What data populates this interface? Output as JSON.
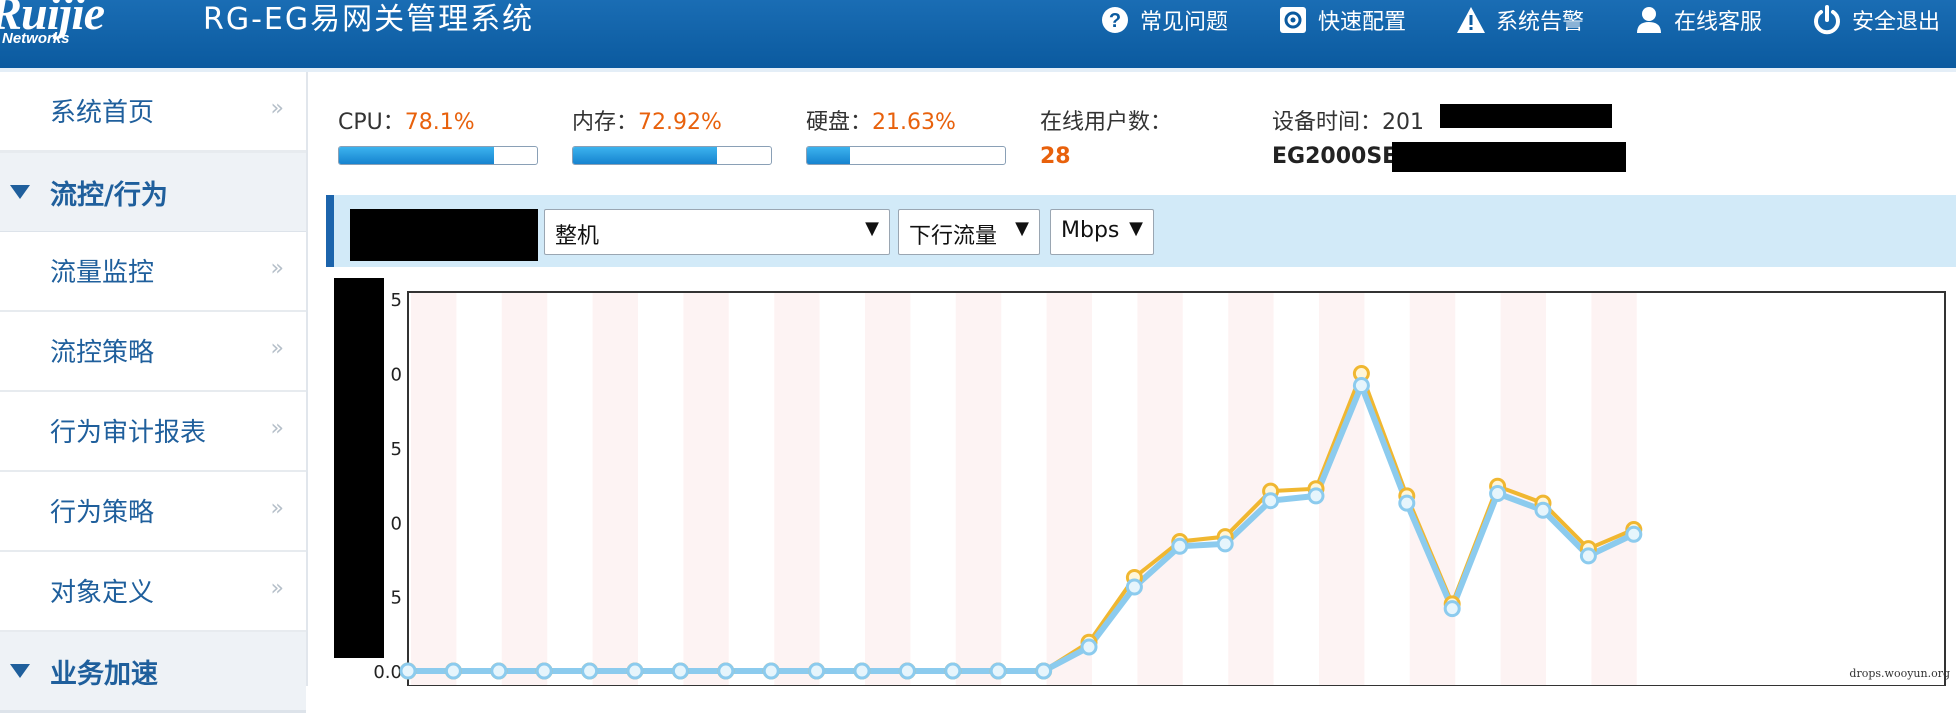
{
  "header": {
    "logo_text": "Ruijie",
    "logo_sub": "Networks",
    "app_title": "RG-EG易网关管理系统",
    "nav": [
      {
        "label": "常见问题",
        "icon": "help-icon"
      },
      {
        "label": "快速配置",
        "icon": "gear-icon"
      },
      {
        "label": "系统告警",
        "icon": "warning-icon"
      },
      {
        "label": "在线客服",
        "icon": "user-icon"
      },
      {
        "label": "安全退出",
        "icon": "power-icon"
      }
    ]
  },
  "sidebar": {
    "home": "系统首页",
    "arrow": "»",
    "group1": "流控/行为",
    "items": [
      "流量监控",
      "流控策略",
      "行为审计报表",
      "行为策略",
      "对象定义"
    ],
    "group2": "业务加速"
  },
  "stats": {
    "cpu_label": "CPU：",
    "cpu_value": "78.1%",
    "cpu_level": 0.781,
    "mem_label": "内存：",
    "mem_value": "72.92%",
    "mem_level": 0.7292,
    "disk_label": "硬盘：",
    "disk_value": "21.63%",
    "disk_level": 0.2163,
    "users_label": "在线用户数：",
    "users_value": "28",
    "time_label": "设备时间：",
    "time_value": "201",
    "model": "EG2000SE"
  },
  "toolbar": {
    "device_select": "整机",
    "direction_select": "下行流量",
    "unit_select": "Mbps",
    "caret": "▼"
  },
  "colors": {
    "header_blue": "#0b5a9f",
    "value_orange": "#e8610c",
    "line_orange": "#f0b731",
    "line_blue": "#8ccbee"
  },
  "watermark": "drops.wooyun.org",
  "chart_data": {
    "type": "line",
    "y_tick_labels": [
      "0.0",
      "5",
      "0",
      "5",
      "0",
      "5"
    ],
    "x": [
      0,
      1,
      2,
      3,
      4,
      5,
      6,
      7,
      8,
      9,
      10,
      11,
      12,
      13,
      14,
      15,
      16,
      17,
      18,
      19,
      20,
      21,
      22,
      23,
      24,
      25,
      26,
      27
    ],
    "series": [
      {
        "values": [
          0,
          0,
          0,
          0,
          0,
          0,
          0,
          0,
          0,
          0,
          0,
          0,
          0,
          0,
          0,
          1.2,
          3.9,
          5.4,
          5.6,
          7.5,
          7.6,
          12.4,
          7.3,
          2.8,
          7.7,
          7.0,
          5.1,
          5.9
        ]
      },
      {
        "values": [
          0,
          0,
          0,
          0,
          0,
          0,
          0,
          0,
          0,
          0,
          0,
          0,
          0,
          0,
          0,
          1.0,
          3.5,
          5.2,
          5.3,
          7.1,
          7.3,
          11.9,
          7.0,
          2.6,
          7.4,
          6.7,
          4.8,
          5.7
        ]
      }
    ],
    "ylim": [
      0,
      15.8
    ],
    "grid": true
  }
}
